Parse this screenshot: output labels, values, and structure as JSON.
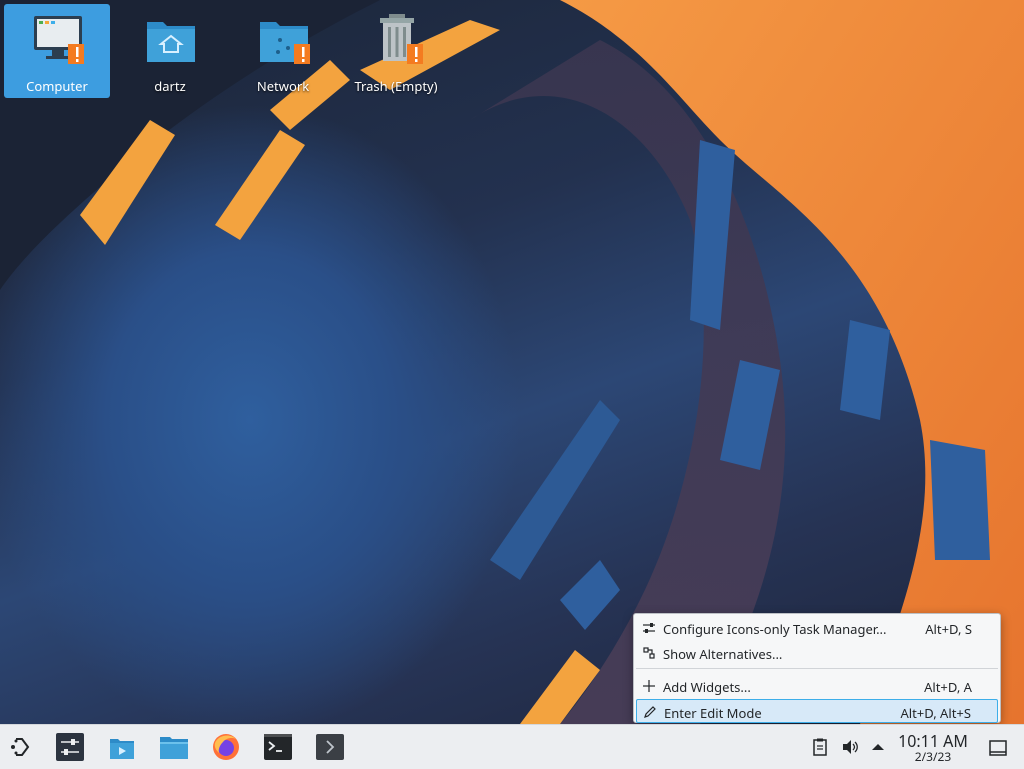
{
  "desktop": {
    "icons": [
      {
        "label": "Computer",
        "selected": true
      },
      {
        "label": "dartz",
        "selected": false
      },
      {
        "label": "Network",
        "selected": false
      },
      {
        "label": "Trash (Empty)",
        "selected": false
      }
    ]
  },
  "context_menu": {
    "items": [
      {
        "label": "Configure Icons-only Task Manager...",
        "shortcut": "Alt+D, S",
        "icon": "configure-icon"
      },
      {
        "label": "Show Alternatives...",
        "shortcut": "",
        "icon": "alternatives-icon"
      },
      {
        "label": "Add Widgets...",
        "shortcut": "Alt+D, A",
        "icon": "plus-icon"
      },
      {
        "label": "Enter Edit Mode",
        "shortcut": "Alt+D, Alt+S",
        "icon": "pencil-icon",
        "highlighted": true
      }
    ]
  },
  "taskbar": {
    "launchers": [
      "application-launcher-icon",
      "system-settings-icon",
      "discover-icon",
      "dolphin-icon",
      "firefox-icon",
      "konsole-icon",
      "terminal-window-icon"
    ],
    "tray": [
      "clipboard-icon",
      "volume-icon",
      "tray-expand-icon"
    ],
    "clock": {
      "time": "10:11 AM",
      "date": "2/3/23"
    }
  },
  "colors": {
    "selection": "#3d9de0",
    "highlight_border": "#3daee9",
    "folder_blue": "#3fa1d9",
    "warning_orange": "#f47b20",
    "wallpaper_orange": "#f08a3a"
  }
}
